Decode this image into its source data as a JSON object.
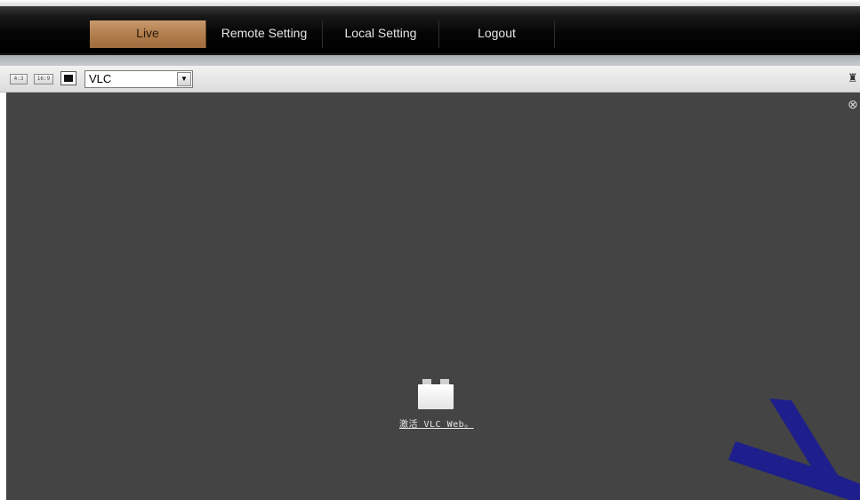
{
  "nav": {
    "tabs": [
      {
        "label": "Live",
        "active": true
      },
      {
        "label": "Remote Setting",
        "active": false
      },
      {
        "label": "Local Setting",
        "active": false
      },
      {
        "label": "Logout",
        "active": false
      }
    ]
  },
  "toolbar": {
    "ratio_4_3": "4:3",
    "ratio_16_9": "16:9",
    "player_select_value": "VLC",
    "player_select_arrow": "▼",
    "right_tool_icon": "♜"
  },
  "video": {
    "close_glyph": "⊗",
    "plugin_link": "激活 VLC Web。"
  },
  "colors": {
    "active_tab": "#b07c4c",
    "video_bg": "#444444",
    "watermark": "#1e1e8c"
  }
}
